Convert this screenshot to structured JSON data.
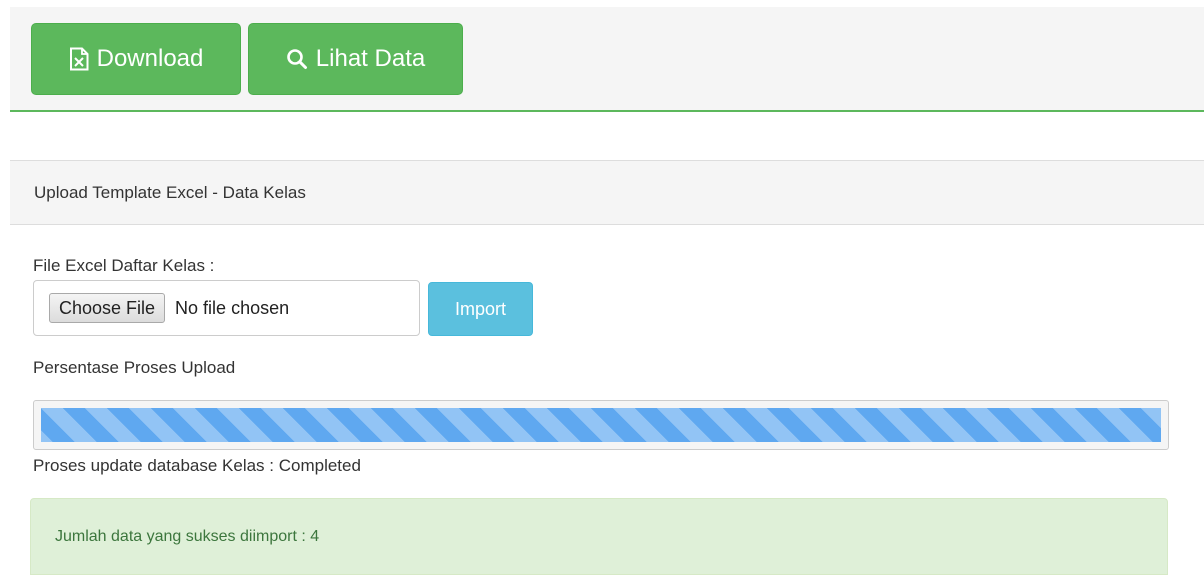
{
  "toolbar": {
    "download_label": "Download",
    "lihat_label": "Lihat Data",
    "download_icon": "file-excel-icon",
    "lihat_icon": "search-icon"
  },
  "panel": {
    "heading": "Upload Template Excel - Data Kelas"
  },
  "form": {
    "file_label": "File Excel Daftar Kelas :",
    "choose_file_label": "Choose File",
    "file_status": "No file chosen",
    "import_label": "Import"
  },
  "progress": {
    "label": "Persentase Proses Upload",
    "percent": 100,
    "status_text": "Proses update database Kelas : Completed"
  },
  "alert": {
    "message": "Jumlah data yang sukses diimport : 4"
  },
  "colors": {
    "success": "#5cb85c",
    "info": "#5bc0de",
    "progress": "#5fa8f0",
    "alert_bg": "#dff0d8",
    "alert_text": "#3c763d"
  }
}
